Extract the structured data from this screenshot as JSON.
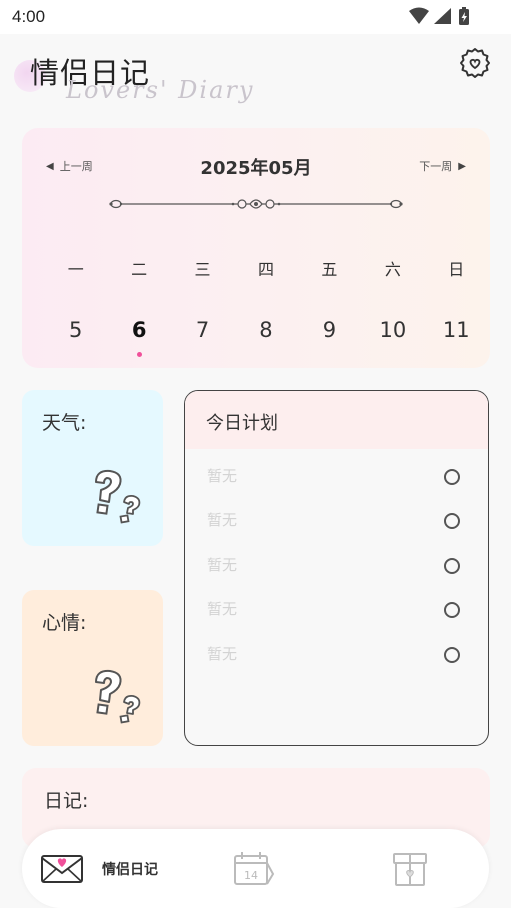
{
  "status_bar": {
    "time": "4:00",
    "icons": [
      "wifi-icon",
      "signal-icon",
      "battery-icon"
    ]
  },
  "header": {
    "title": "情侣日记",
    "subtitle": "Lovers' Diary",
    "settings_icon": "gear-heart-icon"
  },
  "calendar": {
    "prev_week": "上一周",
    "next_week": "下一周",
    "month": "2025年05月",
    "weekdays": [
      "一",
      "二",
      "三",
      "四",
      "五",
      "六",
      "日"
    ],
    "dates": [
      "5",
      "6",
      "7",
      "8",
      "9",
      "10",
      "11"
    ],
    "selected_date": "6",
    "accent_color": "#f0509a"
  },
  "weather": {
    "label": "天气:",
    "icon": "question-marks-icon"
  },
  "mood": {
    "label": "心情:",
    "icon": "question-marks-icon"
  },
  "plan": {
    "title": "今日计划",
    "items": [
      "暂无",
      "暂无",
      "暂无",
      "暂无",
      "暂无"
    ]
  },
  "diary": {
    "label": "日记:"
  },
  "bottom_nav": {
    "items": [
      {
        "label": "情侣日记",
        "icon": "love-letter-icon",
        "active": true
      },
      {
        "label": "",
        "icon": "calendar-14-icon",
        "active": false
      },
      {
        "label": "",
        "icon": "gift-box-icon",
        "active": false
      }
    ]
  }
}
